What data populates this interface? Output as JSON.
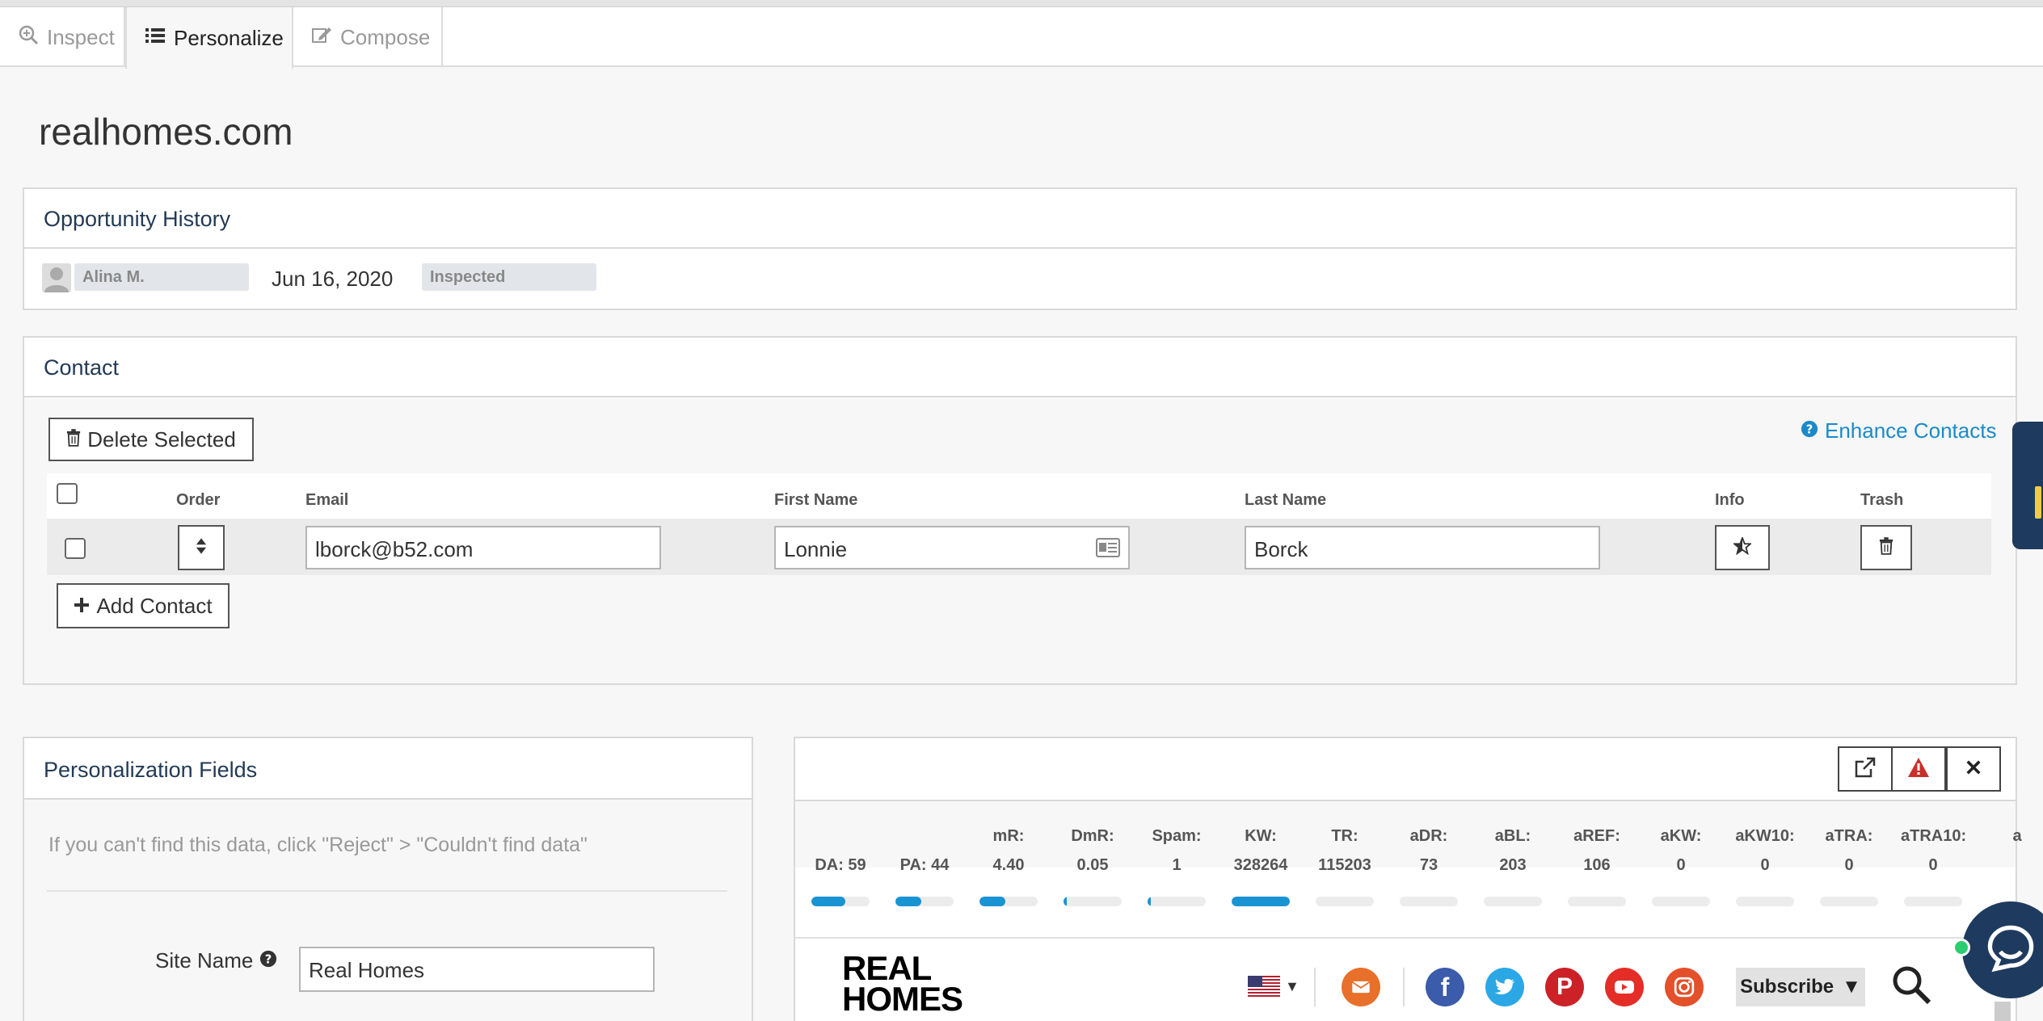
{
  "tabs": [
    {
      "label": "Inspect"
    },
    {
      "label": "Personalize"
    },
    {
      "label": "Compose"
    }
  ],
  "site": {
    "title": "realhomes.com"
  },
  "history": {
    "title": "Opportunity History",
    "user": "Alina M.",
    "date": "Jun 16, 2020",
    "status": "Inspected"
  },
  "contact": {
    "title": "Contact",
    "delete_label": "Delete Selected",
    "enhance_label": "Enhance Contacts",
    "columns": {
      "order": "Order",
      "email": "Email",
      "first": "First Name",
      "last": "Last Name",
      "info": "Info",
      "trash": "Trash"
    },
    "row": {
      "email": "lborck@b52.com",
      "first": "Lonnie",
      "last": "Borck"
    },
    "add_label": "Add Contact"
  },
  "personalization": {
    "title": "Personalization Fields",
    "hint": "If you can't find this data, click \"Reject\" > \"Couldn't find data\"",
    "site_name_label": "Site Name",
    "site_name_value": "Real Homes"
  },
  "metrics": [
    {
      "label": "",
      "value": "DA: 59",
      "fill": 0.59
    },
    {
      "label": "",
      "value": "PA: 44",
      "fill": 0.44
    },
    {
      "label": "mR:",
      "value": "4.40",
      "fill": 0.44
    },
    {
      "label": "DmR:",
      "value": "0.05",
      "fill": 0.05
    },
    {
      "label": "Spam:",
      "value": "1",
      "fill": 0.06
    },
    {
      "label": "KW:",
      "value": "328264",
      "fill": 1.0
    },
    {
      "label": "TR:",
      "value": "115203",
      "fill": 0
    },
    {
      "label": "aDR:",
      "value": "73",
      "fill": 0
    },
    {
      "label": "aBL:",
      "value": "203",
      "fill": 0
    },
    {
      "label": "aREF:",
      "value": "106",
      "fill": 0
    },
    {
      "label": "aKW:",
      "value": "0",
      "fill": 0
    },
    {
      "label": "aKW10:",
      "value": "0",
      "fill": 0
    },
    {
      "label": "aTRA:",
      "value": "0",
      "fill": 0
    },
    {
      "label": "aTRA10:",
      "value": "0",
      "fill": 0
    },
    {
      "label": "a",
      "value": "",
      "fill": 0
    }
  ],
  "preview": {
    "logo_line1": "REAL",
    "logo_line2": "HOMES",
    "subscribe_label": "Subscribe",
    "colors": {
      "accent": "#1a8ac9",
      "bar": "#1a93d3",
      "mail": "#e8702a",
      "facebook": "#3b5bab",
      "twitter": "#2ca7e6",
      "pinterest": "#cc2127",
      "youtube": "#e52d27",
      "instagram": "#e4502a"
    }
  }
}
